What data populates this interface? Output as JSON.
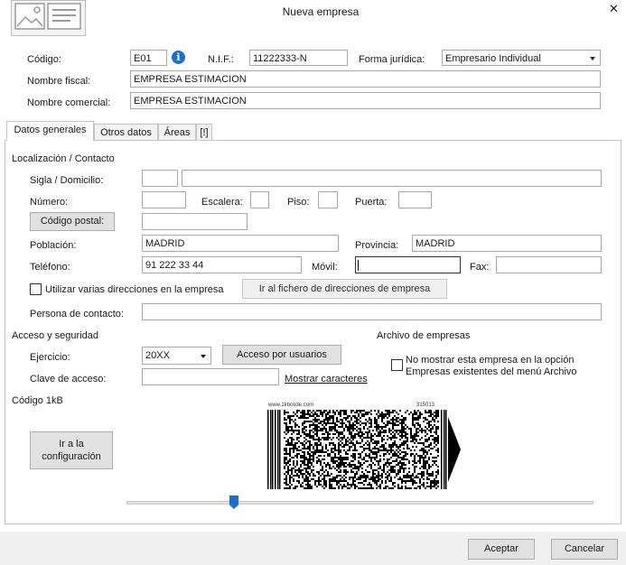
{
  "window": {
    "title": "Nueva empresa",
    "close_symbol": "✕"
  },
  "header": {
    "codigo_label": "Código:",
    "codigo_value": "E01",
    "info_symbol": "i",
    "nif_label": "N.I.F.:",
    "nif_value": "11222333-N",
    "forma_label": "Forma jurídica:",
    "forma_value": "Empresario Individual",
    "fiscal_label": "Nombre fiscal:",
    "fiscal_value": "EMPRESA ESTIMACION",
    "comercial_label": "Nombre comercial:",
    "comercial_value": "EMPRESA ESTIMACION"
  },
  "tabs": [
    {
      "label": "Datos generales",
      "active": true
    },
    {
      "label": "Otros datos"
    },
    {
      "label": "Áreas"
    },
    {
      "label": "[!]"
    }
  ],
  "localizacion": {
    "title": "Localización / Contacto",
    "sigla_label": "Sigla / Domicilio:",
    "numero_label": "Número:",
    "escalera_label": "Escalera:",
    "piso_label": "Piso:",
    "puerta_label": "Puerta:",
    "cp_button": "Código postal:",
    "poblacion_label": "Población:",
    "poblacion_value": "MADRID",
    "provincia_label": "Provincia:",
    "provincia_value": "MADRID",
    "telefono_label": "Teléfono:",
    "telefono_value": "91 222 33 44",
    "movil_label": "Móvil:",
    "fax_label": "Fax:",
    "varias_label": "Utilizar varias direcciones en la empresa",
    "fichero_button": "Ir al fichero de direcciones de empresa",
    "contacto_label": "Persona de contacto:"
  },
  "acceso": {
    "title": "Acceso y seguridad",
    "ejercicio_label": "Ejercicio:",
    "ejercicio_value": "20XX",
    "acceso_button": "Acceso por usuarios",
    "clave_label": "Clave de acceso:",
    "mostrar_link": "Mostrar caracteres"
  },
  "archivo": {
    "title": "Archivo de empresas",
    "line1": "No mostrar esta empresa en la opción",
    "line2": "Empresas existentes del menú Archivo"
  },
  "codigo1kb": {
    "title": "Código 1kB",
    "config_line1": "Ir a la",
    "config_line2": "configuración",
    "barcode_url": "www.1kbcode.com",
    "barcode_id": "315013",
    "slider_level": 0.23
  },
  "footer": {
    "accept": "Aceptar",
    "cancel": "Cancelar"
  }
}
